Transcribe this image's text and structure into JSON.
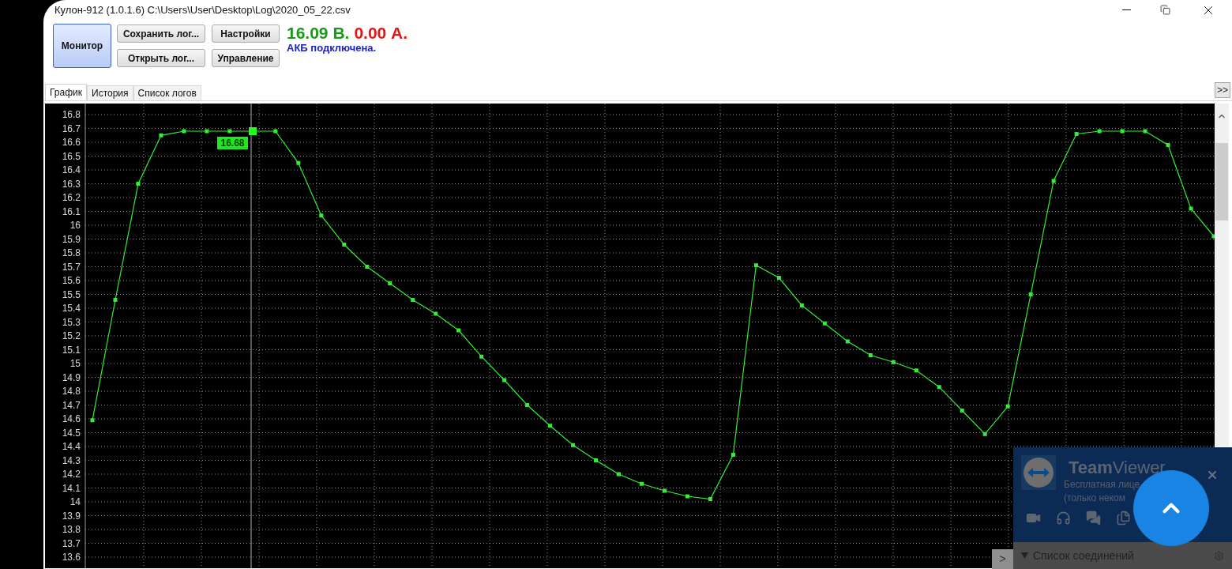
{
  "window": {
    "title": "Кулон-912 (1.0.1.6) C:\\Users\\User\\Desktop\\Log\\2020_05_22.csv"
  },
  "toolbar": {
    "monitor_button": {
      "label": "Монитор",
      "selected": true
    },
    "buttons": [
      {
        "label": "Сохранить лог..."
      },
      {
        "label": "Настройки"
      },
      {
        "label": "Открыть лог..."
      },
      {
        "label": "Управление"
      }
    ]
  },
  "readout": {
    "voltage": "16.09 В.",
    "current": "0.00 А.",
    "status": "АКБ подключена."
  },
  "tabs": [
    {
      "label": "График",
      "selected": true
    },
    {
      "label": "История",
      "selected": false
    },
    {
      "label": "Список логов",
      "selected": false
    }
  ],
  "expand_button": ">>",
  "chart": {
    "chart_data": {
      "type": "line",
      "ylim": [
        13.52,
        16.88
      ],
      "grid": true,
      "yticks": [
        13.6,
        13.7,
        13.8,
        13.9,
        14,
        14.1,
        14.2,
        14.3,
        14.4,
        14.5,
        14.6,
        14.7,
        14.8,
        14.9,
        15,
        15.1,
        15.2,
        15.3,
        15.4,
        15.5,
        15.6,
        15.7,
        15.8,
        15.9,
        16,
        16.1,
        16.2,
        16.3,
        16.4,
        16.5,
        16.6,
        16.7,
        16.8
      ],
      "series": [
        {
          "color": "#33ee33",
          "marker": "square",
          "values": [
            14.59,
            15.46,
            16.3,
            16.65,
            16.68,
            16.68,
            16.68,
            16.68,
            16.68,
            16.45,
            16.07,
            15.86,
            15.7,
            15.58,
            15.46,
            15.36,
            15.24,
            15.05,
            14.88,
            14.7,
            14.55,
            14.41,
            14.3,
            14.2,
            14.13,
            14.08,
            14.04,
            14.02,
            14.34,
            15.71,
            15.62,
            15.42,
            15.29,
            15.16,
            15.06,
            15.01,
            14.95,
            14.83,
            14.66,
            14.49,
            14.69,
            15.5,
            16.32,
            16.66,
            16.68,
            16.68,
            16.68,
            16.58,
            16.12,
            15.92
          ]
        }
      ],
      "annotations": [
        "16.68"
      ]
    }
  },
  "side_toggle": ">",
  "teamviewer": {
    "title": "**Team**Viewer",
    "subtitle": [
      "Бесплатная лице",
      "(только неком"
    ],
    "section": "Список соединений"
  }
}
